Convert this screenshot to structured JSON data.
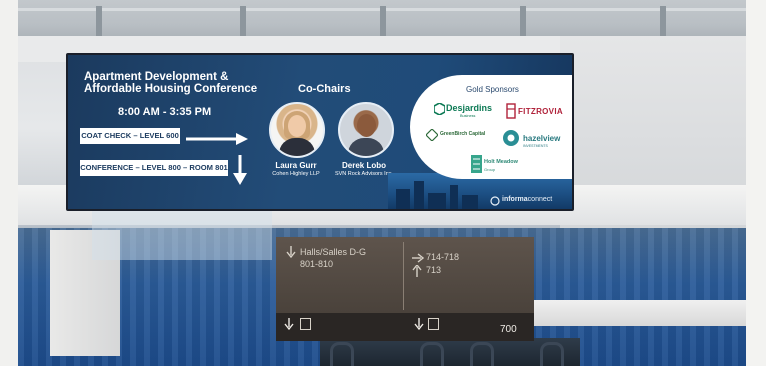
{
  "sign": {
    "title": "Apartment Development & Affordable Housing Conference",
    "time": "8:00 AM - 3:35 PM",
    "coat_check": "COAT CHECK – LEVEL 600",
    "conference": "CONFERENCE – LEVEL 800 – ROOM 801",
    "cochairs_heading": "Co-Chairs",
    "chairs": [
      {
        "name": "Laura Gurr",
        "org": "Cohen Highley LLP"
      },
      {
        "name": "Derek Lobo",
        "org": "SVN Rock Advisors Inc."
      }
    ],
    "sponsors_heading": "Gold Sponsors",
    "sponsors": {
      "desjardins": "Desjardins",
      "desjardins_sub": "Business",
      "fitzrovia": "FITZROVIA",
      "greenbirch": "GreenBirch Capital",
      "hazelview": "hazelview",
      "hazelview_sub": "INVESTMENTS",
      "holt": "Holt Meadow",
      "holt_sub": "Group"
    },
    "footer_brand": "informa",
    "footer_rest": "connect"
  },
  "wayfinding": {
    "left_text": "Halls/Salles D-G",
    "left_rooms": "801-810",
    "right_line1": "714-718",
    "right_line2": "713",
    "level": "700"
  },
  "colors": {
    "sign_navy": "#1f4b79",
    "sponsor_panel": "#ffffff",
    "desjardins_green": "#0d7a55",
    "fitzrovia_red": "#b0223a",
    "carpet_blue": "#1d4c8c"
  }
}
